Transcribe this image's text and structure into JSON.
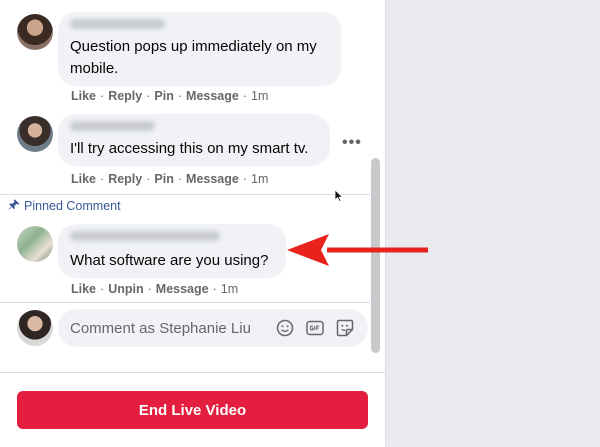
{
  "comments": [
    {
      "message": "Question pops up immediately on my mobile.",
      "message_line1": "Question pops up immediately on my",
      "message_line2": "mobile.",
      "actions": {
        "like": "Like",
        "reply": "Reply",
        "pin": "Pin",
        "message": "Message",
        "time": "1m"
      }
    },
    {
      "message": "I'll try accessing this on my smart tv.",
      "actions": {
        "like": "Like",
        "reply": "Reply",
        "pin": "Pin",
        "message": "Message",
        "time": "1m"
      },
      "more_options": "•••"
    }
  ],
  "pinned": {
    "label": "Pinned Comment",
    "message": "What software are you using?",
    "actions": {
      "like": "Like",
      "unpin": "Unpin",
      "message": "Message",
      "time": "1m"
    }
  },
  "composer": {
    "placeholder": "Comment as Stephanie Liu",
    "icons": [
      "emoji-icon",
      "gif-icon",
      "sticker-icon"
    ]
  },
  "footer": {
    "end_button_label": "End Live Video",
    "accent_color": "#e41e3f"
  },
  "annotation": {
    "arrow_color": "#e8231d"
  },
  "colors": {
    "link_blue": "#385898",
    "muted_text": "#65676b",
    "bubble_bg": "#f0f2f5"
  },
  "separator": "·"
}
